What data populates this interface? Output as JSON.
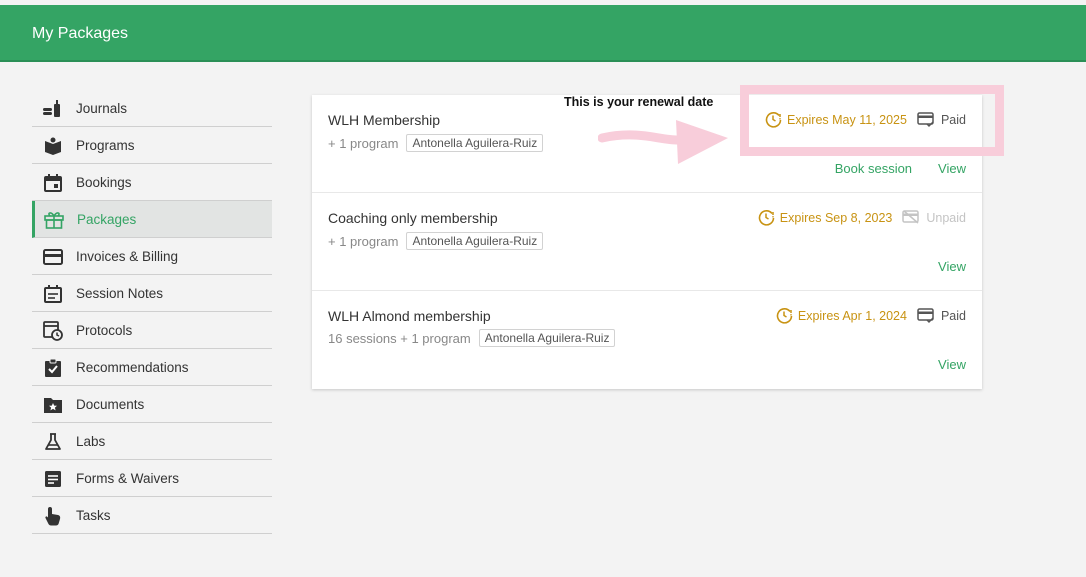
{
  "header": {
    "title": "My Packages"
  },
  "sidebar": {
    "items": [
      {
        "label": "Journals",
        "icon": "journal-icon"
      },
      {
        "label": "Programs",
        "icon": "programs-icon"
      },
      {
        "label": "Bookings",
        "icon": "calendar-icon"
      },
      {
        "label": "Packages",
        "icon": "gift-icon",
        "active": true
      },
      {
        "label": "Invoices & Billing",
        "icon": "credit-card-icon"
      },
      {
        "label": "Session Notes",
        "icon": "notes-icon"
      },
      {
        "label": "Protocols",
        "icon": "protocol-clock-icon"
      },
      {
        "label": "Recommendations",
        "icon": "clipboard-check-icon"
      },
      {
        "label": "Documents",
        "icon": "folder-star-icon"
      },
      {
        "label": "Labs",
        "icon": "flask-icon"
      },
      {
        "label": "Forms & Waivers",
        "icon": "form-icon"
      },
      {
        "label": "Tasks",
        "icon": "hand-pointer-icon"
      }
    ]
  },
  "packages": [
    {
      "title": "WLH Membership",
      "count": "+ 1 program",
      "tag": "Antonella Aguilera-Ruiz",
      "expires": "Expires May 11, 2025",
      "payment": "Paid",
      "actions": {
        "book": "Book session",
        "view": "View"
      }
    },
    {
      "title": "Coaching only membership",
      "count": "+ 1 program",
      "tag": "Antonella Aguilera-Ruiz",
      "expires": "Expires Sep 8, 2023",
      "payment": "Unpaid",
      "actions": {
        "view": "View"
      }
    },
    {
      "title": "WLH Almond membership",
      "count": "16 sessions + 1 program",
      "tag": "Antonella Aguilera-Ruiz",
      "expires": "Expires Apr 1, 2024",
      "payment": "Paid",
      "actions": {
        "view": "View"
      }
    }
  ],
  "annotation": {
    "text": "This is your renewal date"
  },
  "colors": {
    "brand": "#34a464",
    "expires": "#c89313",
    "highlight": "#f8cdda"
  }
}
